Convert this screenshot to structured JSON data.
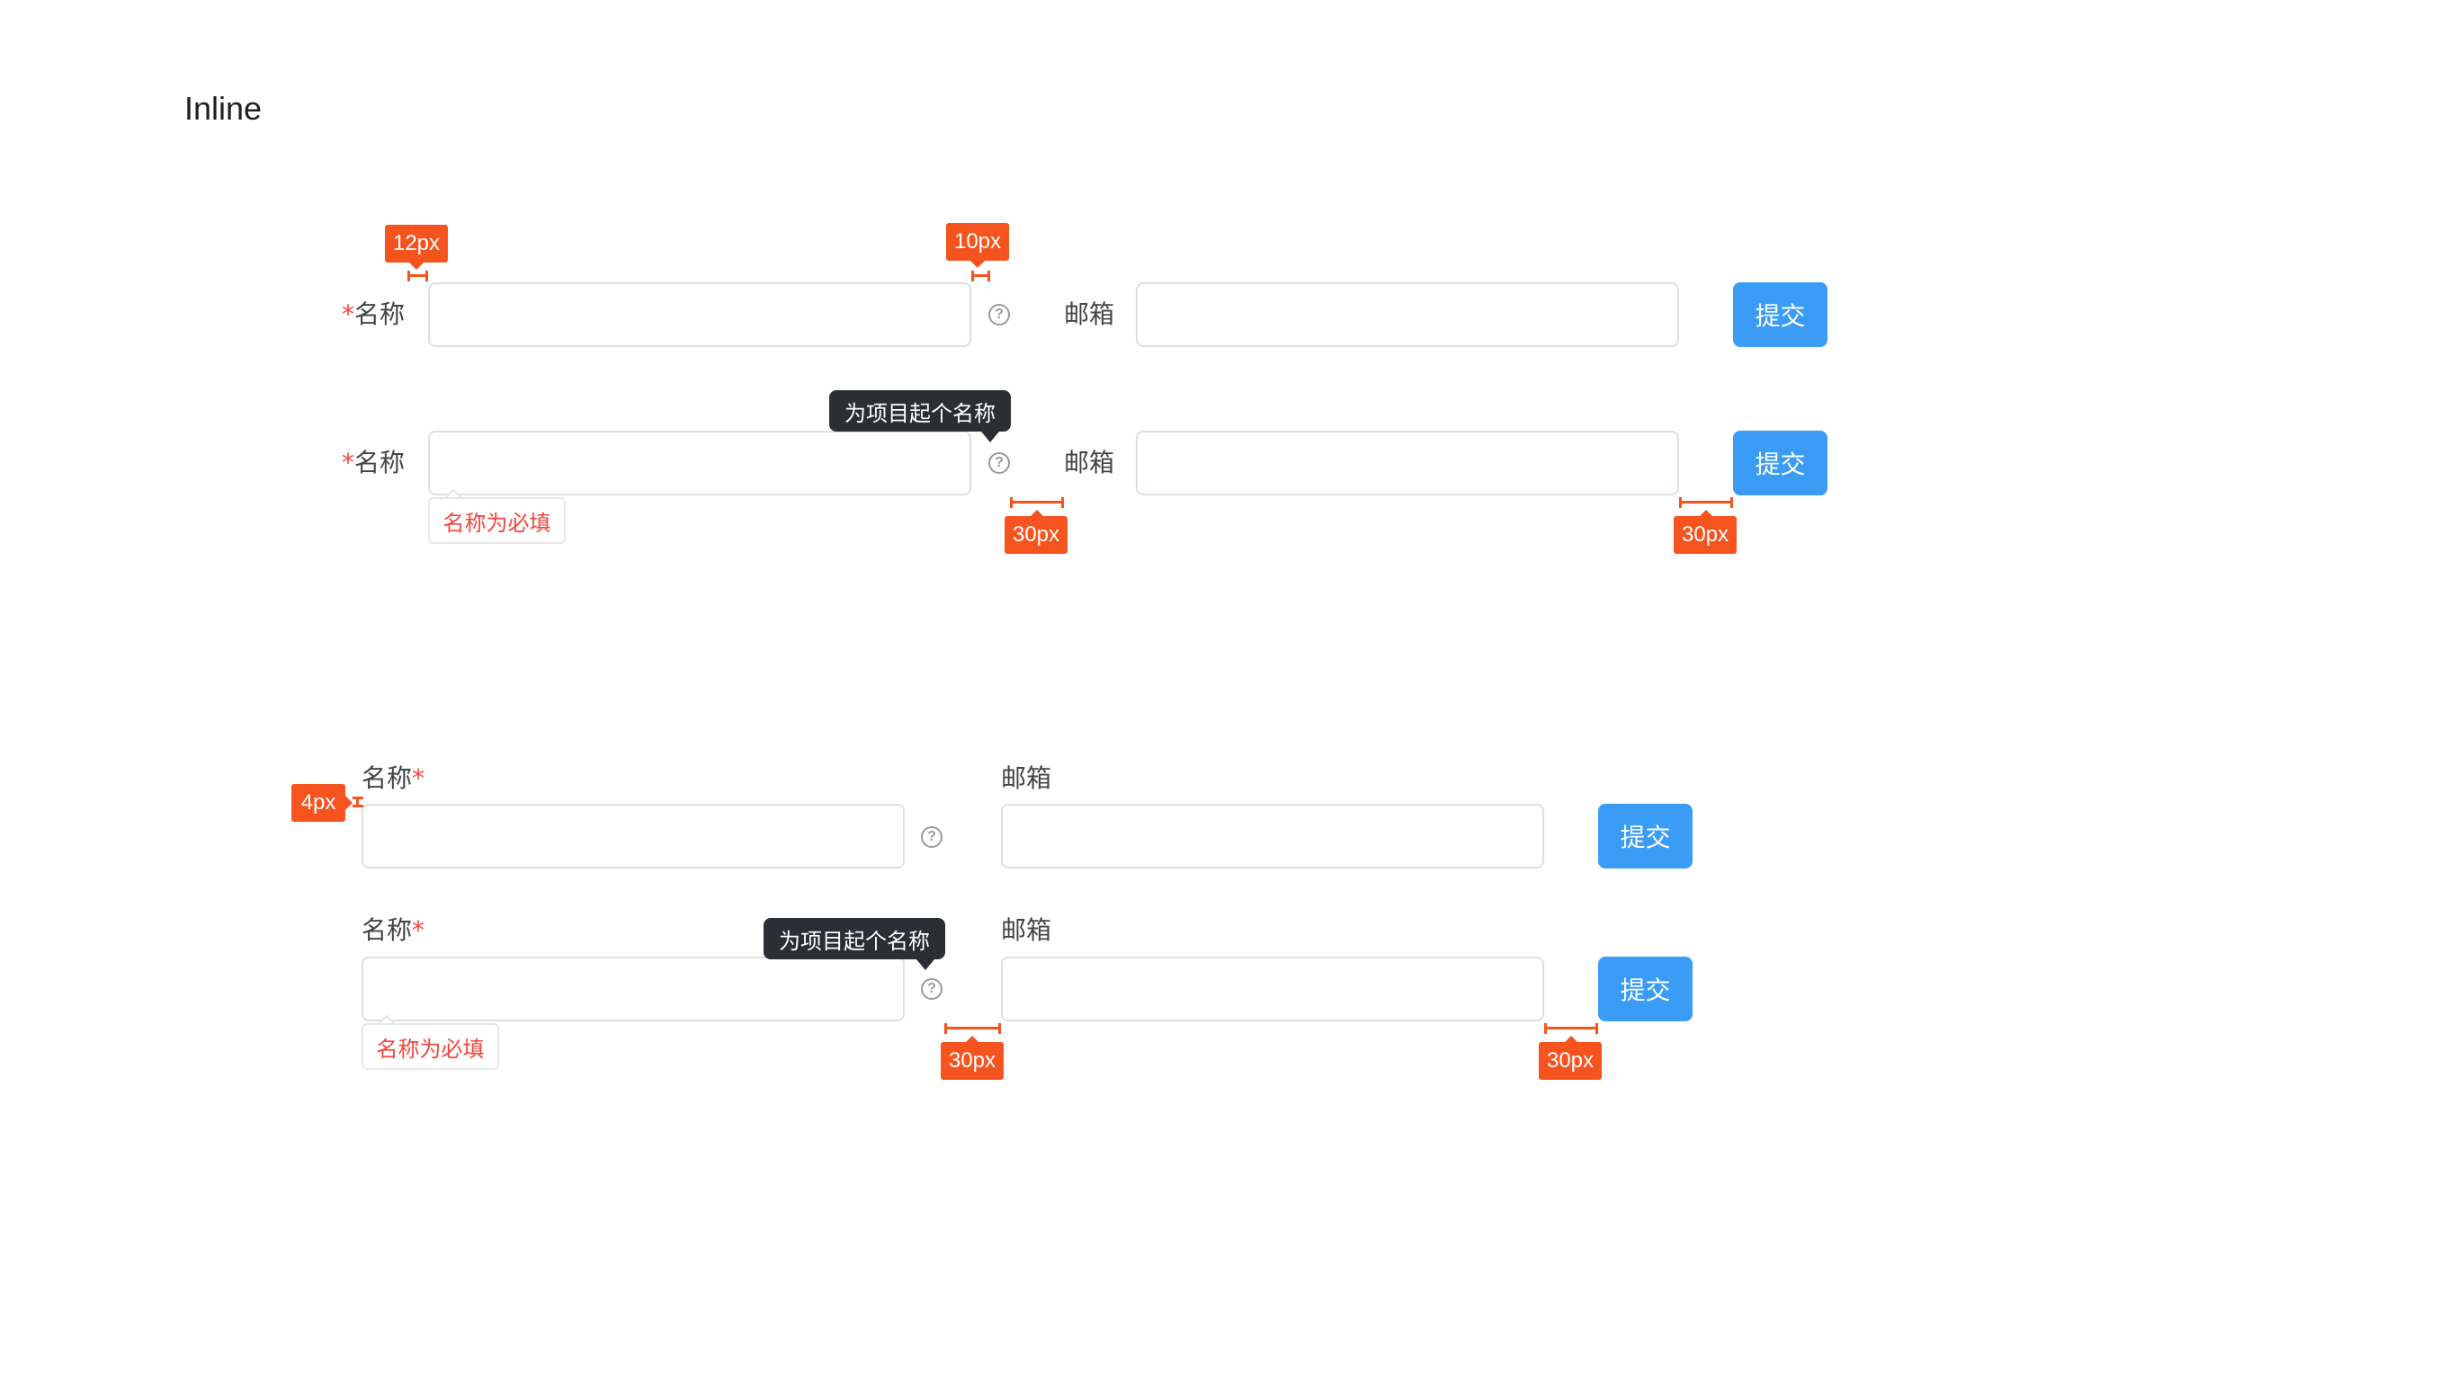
{
  "page": {
    "title": "Inline"
  },
  "form": {
    "name_label": "名称",
    "required_mark": "*",
    "email_label": "邮箱",
    "submit_label": "提交",
    "name_value": "",
    "email_value": "",
    "help_glyph": "?",
    "tooltip_text": "为项目起个名称",
    "error_text": "名称为必填"
  },
  "annotations": {
    "label_gap": "12px",
    "help_gap": "10px",
    "field_gap": "30px",
    "button_gap": "30px",
    "stacked_label_gap": "4px"
  },
  "colors": {
    "primary": "#3a9cf5",
    "required": "#f5463d",
    "annotation": "#f5541f",
    "tooltip_bg": "#2b2e34",
    "input_border": "#dcdfe6"
  }
}
